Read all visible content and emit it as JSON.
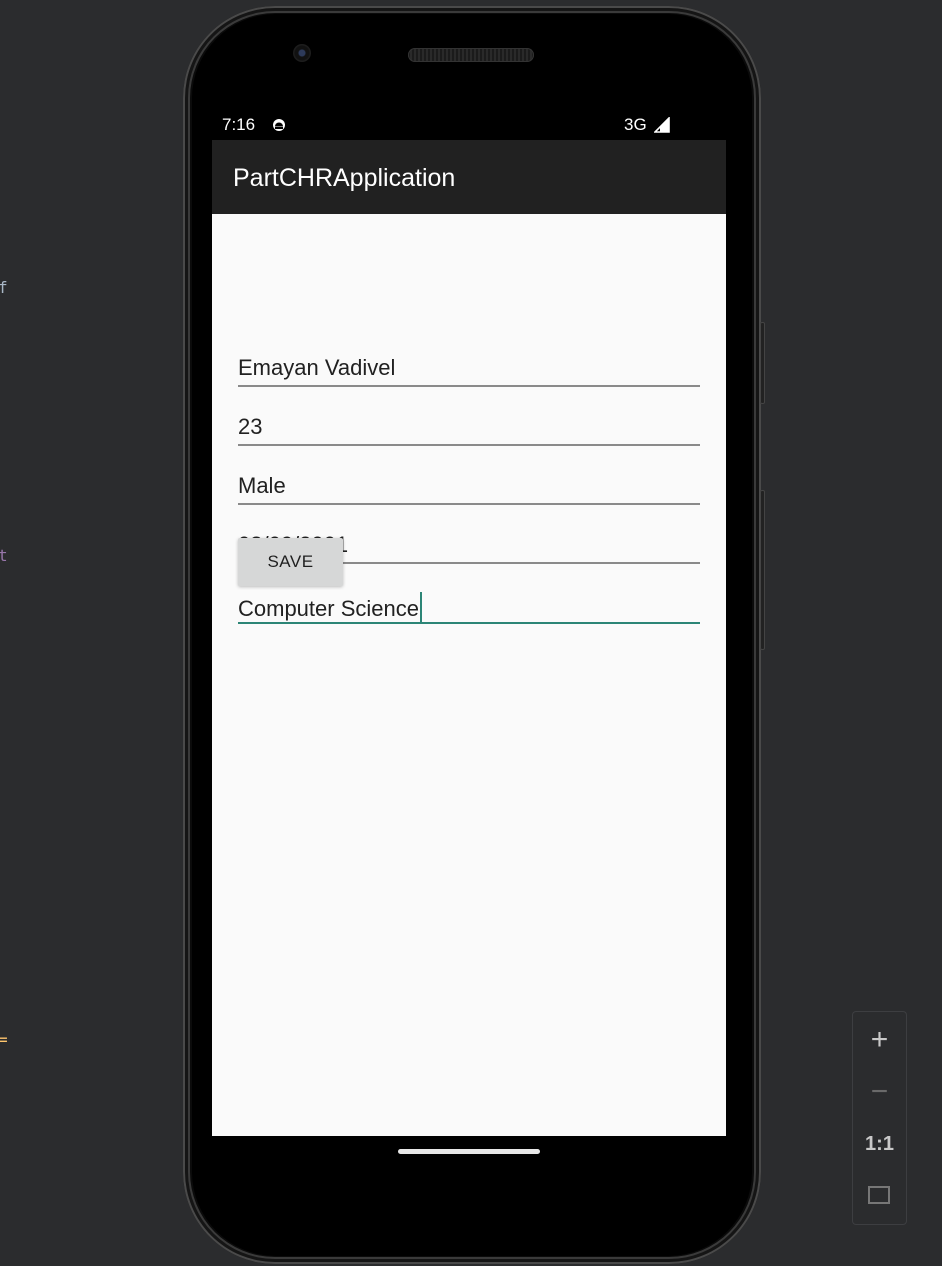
{
  "status_bar": {
    "time": "7:16",
    "network": "3G",
    "notification_icon": "android-notification-icon",
    "signal_icon": "cell-signal-icon"
  },
  "app_bar": {
    "title": "PartCHRApplication"
  },
  "form": {
    "name_value": "Emayan Vadivel",
    "age_value": "23",
    "gender_value": "Male",
    "dob_value": "08/09/2001",
    "department_value": "Computer Science",
    "save_label": "SAVE"
  },
  "zoom_panel": {
    "zoom_in_label": "+",
    "zoom_out_label": "−",
    "actual_size_label": "1:1",
    "fit_icon": "fit-screen-icon"
  },
  "colors": {
    "app_bar": "#212121",
    "accent": "#2c8576",
    "screen_background": "#fafafa",
    "button": "#d6d7d7"
  }
}
